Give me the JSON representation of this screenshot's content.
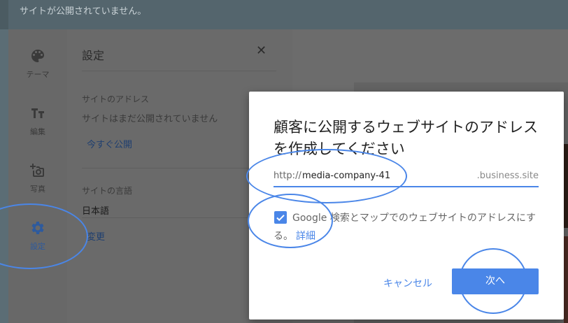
{
  "top_banner": {
    "message": "サイトが公開されていません。"
  },
  "rail": {
    "items": [
      {
        "label": "テーマ",
        "icon": "palette-icon"
      },
      {
        "label": "編集",
        "icon": "text-format-icon"
      },
      {
        "label": "写真",
        "icon": "add-photo-icon"
      },
      {
        "label": "設定",
        "icon": "gear-icon"
      }
    ]
  },
  "settings": {
    "title": "設定",
    "close_icon": "close-icon",
    "address_label": "サイトのアドレス",
    "address_status": "サイトはまだ公開されていません",
    "publish_link": "今すぐ公開",
    "language_label": "サイトの言語",
    "language_value": "日本語",
    "change_link": "変更"
  },
  "dialog": {
    "title": "顧客に公開するウェブサイトのアドレスを作成してください",
    "url_prefix": "http://",
    "url_value": "media-company-41",
    "url_suffix": ".business.site",
    "checkbox_checked": true,
    "checkbox_text": "Google 検索とマップでのウェブサイトのアドレスにする。",
    "detail_link": "詳細",
    "cancel_label": "キャンセル",
    "next_label": "次へ"
  },
  "colors": {
    "accent": "#4a86e8",
    "overlay": "#5b6d75"
  }
}
